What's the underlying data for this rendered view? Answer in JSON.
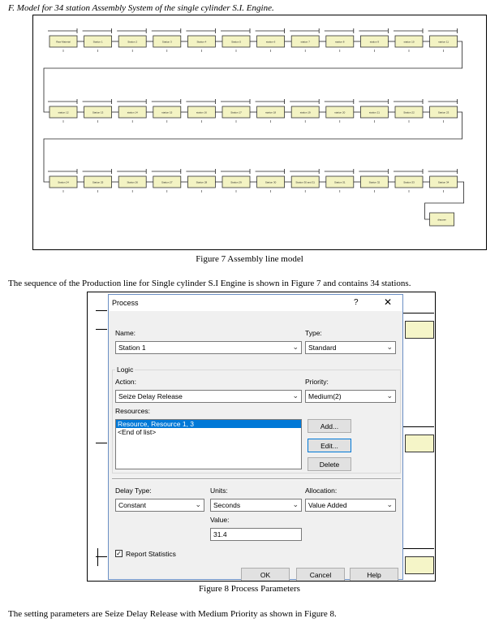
{
  "heading": "F.   Model for 34 station Assembly System of the single cylinder S.I. Engine.",
  "figure7": {
    "caption": "Figure 7 Assembly line model",
    "row1": [
      "Raw Material",
      "Station 1",
      "Station 2",
      "Station 3",
      "Station 4",
      "Station 5",
      "station 6",
      "station 7",
      "station 8",
      "station 9",
      "station 10",
      "station 11"
    ],
    "row2": [
      "station 12",
      "Station 13",
      "station 14",
      "station 15",
      "station 16",
      "Station 17",
      "station 18",
      "station 19",
      "station 20",
      "station 21",
      "Station 22",
      "Station 23"
    ],
    "row3": [
      "Station 24",
      "Station 25",
      "Station 26",
      "Station 27",
      "Station 28",
      "Station 29",
      "Station 30",
      "Station 30 and 31",
      "Station 31",
      "Station 32",
      "Station 33",
      "Station 34"
    ],
    "dispose_label": "dispose"
  },
  "paragraph1": "The sequence of the Production line for Single cylinder S.I Engine is shown in Figure 7 and contains 34 stations.",
  "figure8": {
    "caption": "Figure 8 Process Parameters",
    "dialog": {
      "title": "Process",
      "help_glyph": "?",
      "close_glyph": "✕",
      "name_label": "Name:",
      "name_value": "Station 1",
      "type_label": "Type:",
      "type_value": "Standard",
      "logic_label": "Logic",
      "action_label": "Action:",
      "action_value": "Seize Delay Release",
      "priority_label": "Priority:",
      "priority_value": "Medium(2)",
      "resources_label": "Resources:",
      "resources_items": [
        "Resource, Resource 1, 3",
        "<End of list>"
      ],
      "add_button": "Add...",
      "edit_button": "Edit...",
      "delete_button": "Delete",
      "delay_type_label": "Delay Type:",
      "delay_type_value": "Constant",
      "units_label": "Units:",
      "units_value": "Seconds",
      "allocation_label": "Allocation:",
      "allocation_value": "Value Added",
      "value_label": "Value:",
      "value_value": "31.4",
      "report_statistics_label": "Report Statistics",
      "report_statistics_checked": true,
      "ok_button": "OK",
      "cancel_button": "Cancel",
      "help_button": "Help"
    }
  },
  "paragraph2": "The setting parameters are Seize Delay Release with Medium Priority as shown in Figure 8."
}
